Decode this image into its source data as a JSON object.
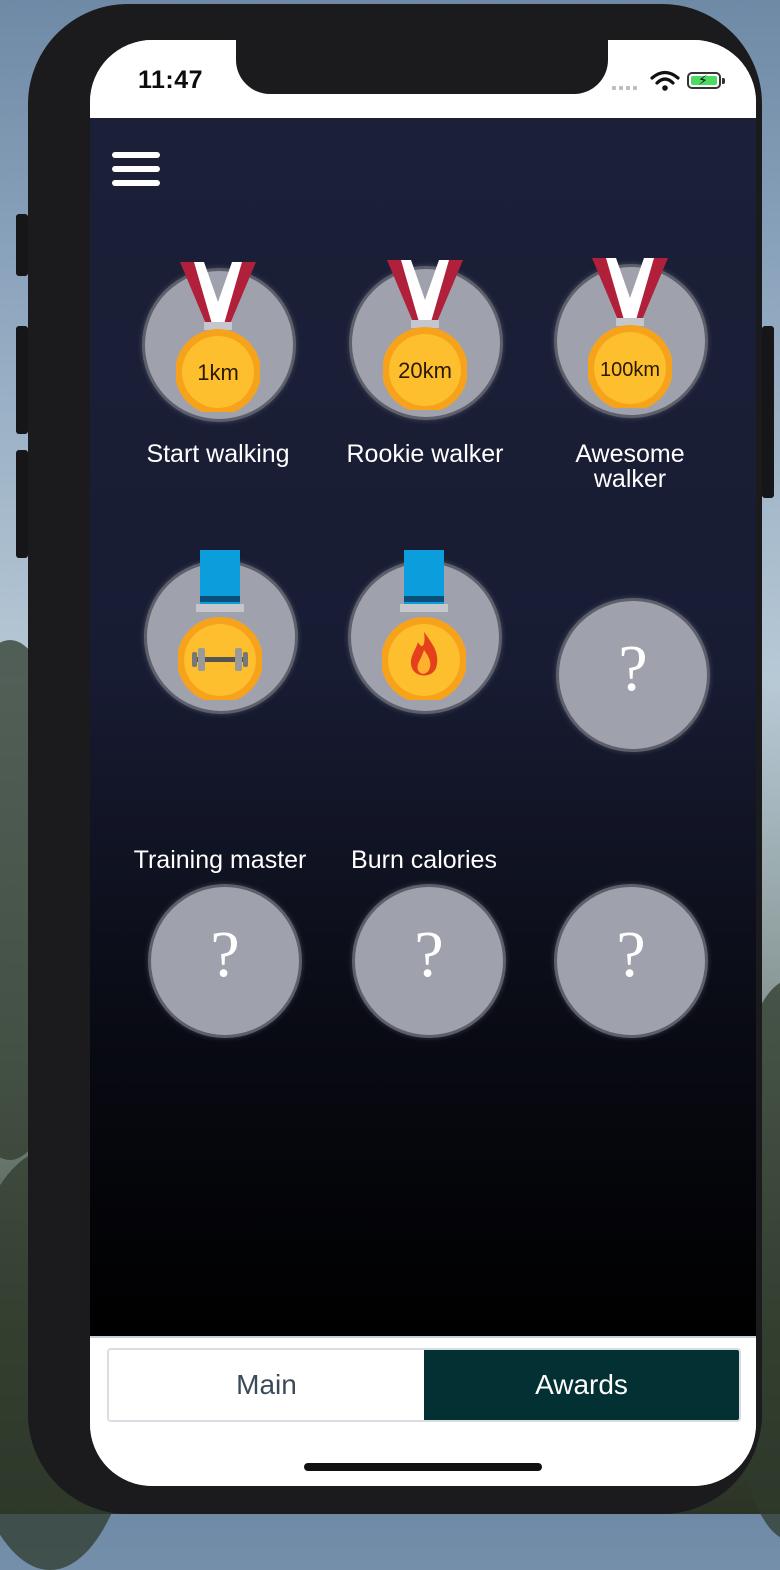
{
  "status_bar": {
    "time": "11:47"
  },
  "awards": [
    {
      "label": "Start walking",
      "medal_text": "1km",
      "ribbon": "red-white",
      "locked": false
    },
    {
      "label": "Rookie walker",
      "medal_text": "20km",
      "ribbon": "red-white",
      "locked": false
    },
    {
      "label": "Awesome walker",
      "medal_text": "100km",
      "ribbon": "red-white",
      "locked": false
    },
    {
      "label": "Training master",
      "medal_icon": "dumbbell-icon",
      "ribbon": "blue",
      "locked": false
    },
    {
      "label": "Burn calories",
      "medal_icon": "flame-icon",
      "ribbon": "blue",
      "locked": false
    },
    {
      "label": "",
      "locked": true,
      "placeholder": "?"
    },
    {
      "label": "",
      "locked": true,
      "placeholder": "?"
    },
    {
      "label": "",
      "locked": true,
      "placeholder": "?"
    },
    {
      "label": "",
      "locked": true,
      "placeholder": "?"
    }
  ],
  "tabs": {
    "main": "Main",
    "awards": "Awards",
    "active": "Awards"
  },
  "colors": {
    "active_tab": "#033033",
    "medal_gold": "#fdbf2d",
    "ribbon_red": "#b0203a",
    "ribbon_blue": "#0b9ddc",
    "badge_bg": "#9fa2ac"
  }
}
